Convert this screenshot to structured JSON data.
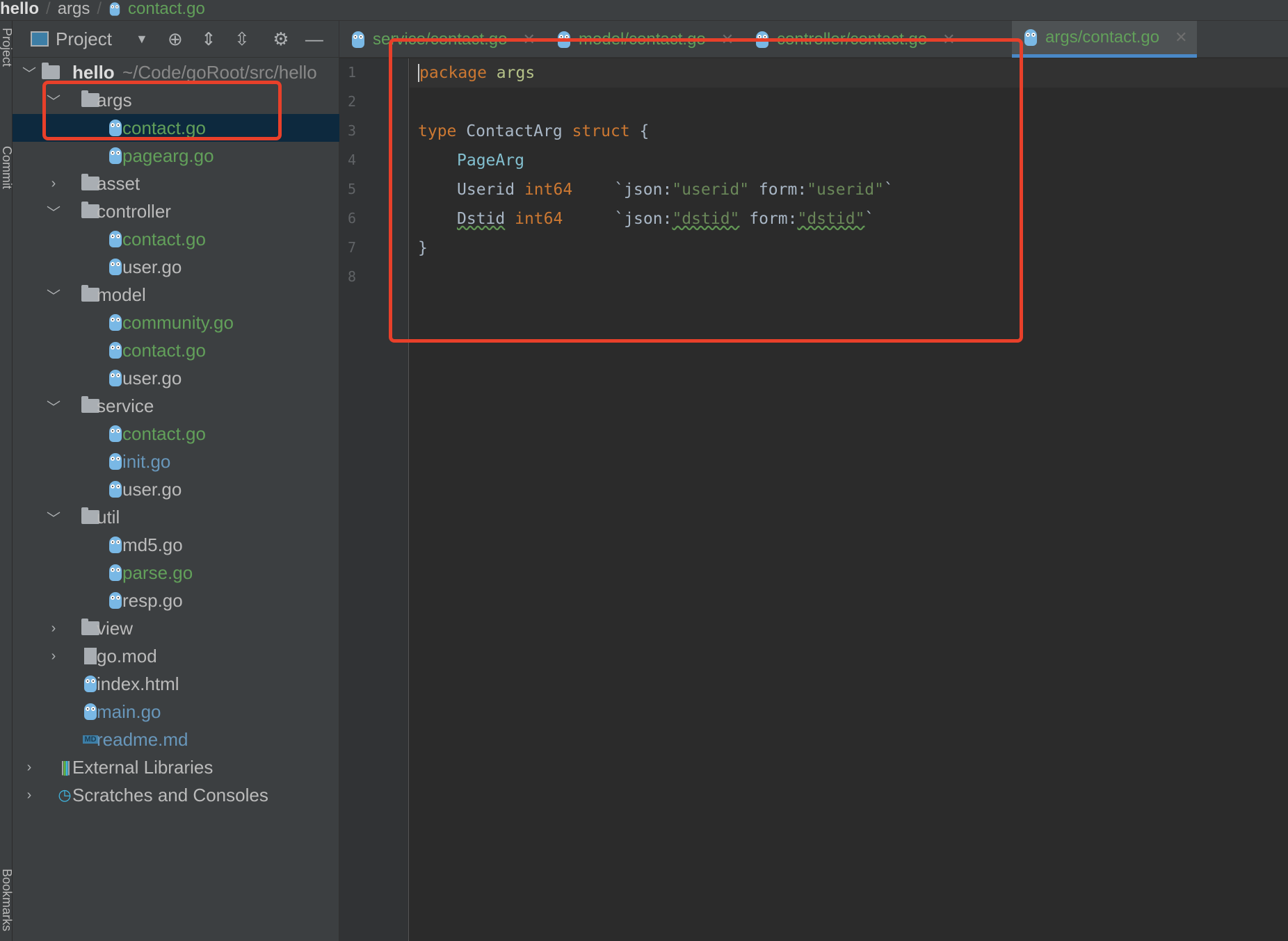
{
  "breadcrumb": [
    "hello",
    "args",
    "contact.go"
  ],
  "side_strip": [
    "Project",
    "Commit",
    "Bookmarks"
  ],
  "project_panel": {
    "title": "Project",
    "root": {
      "name": "hello",
      "path": "~/Code/goRoot/src/hello"
    },
    "rows": [
      {
        "level": 1,
        "kind": "folder",
        "name": "args",
        "expanded": true,
        "color": "#bbbbbb"
      },
      {
        "level": 2,
        "kind": "go",
        "name": "contact.go",
        "color": "#62a05a",
        "selected": true
      },
      {
        "level": 2,
        "kind": "go",
        "name": "pagearg.go",
        "color": "#62a05a"
      },
      {
        "level": 1,
        "kind": "folder",
        "name": "asset",
        "expanded": false,
        "color": "#bbbbbb"
      },
      {
        "level": 1,
        "kind": "folder",
        "name": "controller",
        "expanded": true,
        "color": "#bbbbbb"
      },
      {
        "level": 2,
        "kind": "go",
        "name": "contact.go",
        "color": "#62a05a"
      },
      {
        "level": 2,
        "kind": "go",
        "name": "user.go",
        "color": "#bbbbbb"
      },
      {
        "level": 1,
        "kind": "folder",
        "name": "model",
        "expanded": true,
        "color": "#bbbbbb"
      },
      {
        "level": 2,
        "kind": "go",
        "name": "community.go",
        "color": "#62a05a"
      },
      {
        "level": 2,
        "kind": "go",
        "name": "contact.go",
        "color": "#62a05a"
      },
      {
        "level": 2,
        "kind": "go",
        "name": "user.go",
        "color": "#bbbbbb"
      },
      {
        "level": 1,
        "kind": "folder",
        "name": "service",
        "expanded": true,
        "color": "#bbbbbb"
      },
      {
        "level": 2,
        "kind": "go",
        "name": "contact.go",
        "color": "#62a05a"
      },
      {
        "level": 2,
        "kind": "go",
        "name": "init.go",
        "color": "#6897bb"
      },
      {
        "level": 2,
        "kind": "go",
        "name": "user.go",
        "color": "#bbbbbb"
      },
      {
        "level": 1,
        "kind": "folder",
        "name": "util",
        "expanded": true,
        "color": "#bbbbbb"
      },
      {
        "level": 2,
        "kind": "go",
        "name": "md5.go",
        "color": "#bbbbbb"
      },
      {
        "level": 2,
        "kind": "go",
        "name": "parse.go",
        "color": "#62a05a"
      },
      {
        "level": 2,
        "kind": "go",
        "name": "resp.go",
        "color": "#bbbbbb"
      },
      {
        "level": 1,
        "kind": "folder",
        "name": "view",
        "expanded": false,
        "color": "#bbbbbb"
      },
      {
        "level": 1,
        "kind": "mod",
        "name": "go.mod",
        "expanded": false,
        "color": "#bbbbbb"
      },
      {
        "level": 1,
        "kind": "html",
        "name": "index.html",
        "color": "#bbbbbb"
      },
      {
        "level": 1,
        "kind": "go",
        "name": "main.go",
        "color": "#6897bb"
      },
      {
        "level": 1,
        "kind": "md",
        "name": "readme.md",
        "color": "#6897bb"
      },
      {
        "level": 0,
        "kind": "libs",
        "name": "External Libraries",
        "expanded": false,
        "color": "#bbbbbb"
      },
      {
        "level": 0,
        "kind": "scratch",
        "name": "Scratches and Consoles",
        "expanded": false,
        "color": "#bbbbbb"
      }
    ]
  },
  "tabs": [
    {
      "label": "service/contact.go",
      "left": 0
    },
    {
      "label": "model/contact.go"
    },
    {
      "label": "controller/contact.go"
    },
    {
      "label": "args/contact.go",
      "active": true
    }
  ],
  "code": {
    "line_numbers": [
      "1",
      "2",
      "3",
      "4",
      "5",
      "6",
      "7",
      "8"
    ],
    "l1": {
      "kw": "package",
      "name": "args"
    },
    "l3": {
      "kw": "type",
      "name": "ContactArg",
      "kw2": "struct",
      "brace": "{"
    },
    "l4": {
      "embed": "PageArg"
    },
    "l5": {
      "field": "Userid",
      "type": "int64",
      "t1": "`json:",
      "s1": "\"userid\"",
      "t2": " form:",
      "s2": "\"userid\"",
      "t3": "`"
    },
    "l6": {
      "field": "Dstid",
      "type": "int64",
      "t1": "`json:",
      "s1": "\"dstid\"",
      "t2": " form:",
      "s2": "\"dstid\"",
      "t3": "`"
    },
    "l7": {
      "brace": "}"
    }
  },
  "highlight_color": "#e8402a"
}
